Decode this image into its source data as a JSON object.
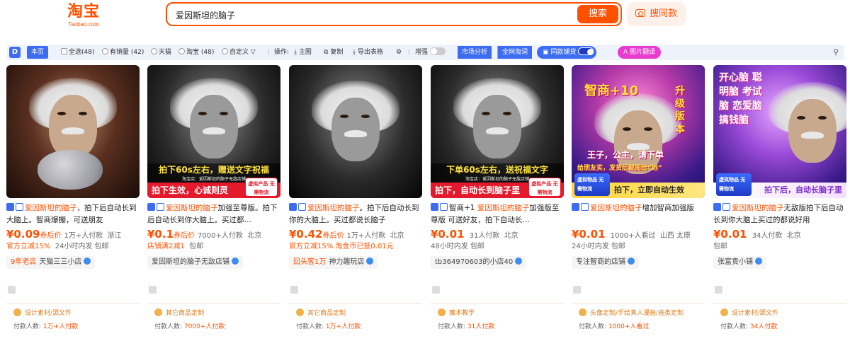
{
  "header": {
    "logo_cn": "淘宝",
    "logo_en": "Taobao.com",
    "search_query": "爱因斯坦的脑子",
    "search_button": "搜索",
    "same_style_button": "搜同款"
  },
  "toolbar": {
    "logo": "D",
    "this_page": "本页",
    "select_all": "全选(48)",
    "has_sales": "有销量 (42)",
    "tmall": "天猫",
    "taobao": "淘宝 (48)",
    "custom": "自定义",
    "ops_label": "操作:",
    "main_image": "主图",
    "copy": "复制",
    "export": "导出表格",
    "enhance": "增强",
    "market_analysis": "市场分析",
    "all_web": "全网淘词",
    "same_shop": "同款铺货",
    "image_translate": "图片翻译"
  },
  "products": [
    {
      "banner": "",
      "title_kw": "爱因斯坦的脑子",
      "title_prefix": "",
      "title_rest": "，拍下后自动长到大脑上。智商爆棚，可送朋友",
      "price": "¥0.09",
      "price_suffix": "券后价",
      "sales": "1万+人付款",
      "location": "浙江",
      "promo_red": "官方立减15%",
      "promo_grey": "24小时内发  包邮",
      "shop_badge": "9年老店",
      "shop": "天猫三三小店",
      "category": "设计素材/源文件",
      "paid_label": "付款人数:",
      "paid_value": "1万+人付款"
    },
    {
      "banner": "拍下60s左右，赠送文字祝福",
      "banner_small": "淘宝店：爱因斯坦的脑子无敌店铺",
      "banner2": "拍下生效，心诚则灵",
      "vtag": "虚拟产品 无需物流",
      "title_kw": "爱因斯坦的脑子",
      "title_prefix": "",
      "title_rest": "加强至尊版。拍下后自动长到你大脑上。买过都…",
      "price": "¥0.1",
      "price_suffix": "券后价",
      "sales": "7000+人付款",
      "location": "北京",
      "promo_red": "店铺满2减1",
      "promo_grey": "包邮",
      "shop_badge": "",
      "shop": "爱因斯坦的脑子无敌店铺",
      "category": "其它商品定制",
      "paid_label": "付款人数:",
      "paid_value": "7000+人付款"
    },
    {
      "banner": "",
      "title_kw": "爱因斯坦的脑子",
      "title_prefix": "",
      "title_rest": "。拍下后自动长到你的大脑上。买过都说长脑子",
      "price": "¥0.42",
      "price_suffix": "券后价",
      "sales": "1万+人付款",
      "location": "北京",
      "promo_red": "官方立减15%  淘金币已抵0.01元",
      "promo_grey": "",
      "shop_badge": "回头客1万",
      "shop": "神力趣玩店",
      "category": "其它商品定制",
      "paid_label": "付款人数:",
      "paid_value": "1万+人付款"
    },
    {
      "banner": "下单60s左右，送祝福文字",
      "banner_small": "淘宝店：爱因斯坦的脑子无敌店铺",
      "banner2": "拍下，自动长到脑子里",
      "vtag": "虚拟产品 无需物流",
      "title_kw": "爱因斯坦的脑子",
      "title_prefix": "智商+1 ",
      "title_rest": "加强版至尊版 可送好友，拍下自动长…",
      "price": "¥0.01",
      "price_suffix": "",
      "sales": "31人付款",
      "location": "北京",
      "promo_red": "",
      "promo_grey": "48小时内发  包邮",
      "shop_badge": "",
      "shop": "tb364970603的小店40",
      "category": "魔术教学",
      "paid_label": "付款人数:",
      "paid_value": "31人付款"
    },
    {
      "banner": "拍下，立即自动生效",
      "big_text": "智商+10",
      "side_text": "升级版本",
      "mid_text": "王子，公主，请下单",
      "mid_text2": "给朋友买，发货后截图给“她”",
      "vtag": "虚拟物品 无需物流",
      "title_kw": "爱因斯坦的脑子",
      "title_prefix": "",
      "title_rest": "增加智商加强版",
      "price": "¥0.01",
      "price_suffix": "",
      "sales": "1000+人看过",
      "location": "山西 太原",
      "promo_red": "",
      "promo_grey": "24小时内发  包邮",
      "shop_badge": "",
      "shop": "专注智商的店铺",
      "category": "头像定制/手绘真人漫画/画类定制",
      "paid_label": "付款人数:",
      "paid_value": "1000+人看过"
    },
    {
      "banner": "拍下后，自动长脑子里",
      "big_text": "开心脑 聪明脑 考试脑 恋爱脑 搞钱脑",
      "vtag": "虚拟物品 无需物流",
      "title_kw": "爱因斯坦的脑子",
      "title_prefix": "",
      "title_rest": "无敌版拍下后自动长到你大脑上买过的都说好用",
      "price": "¥0.01",
      "price_suffix": "",
      "sales": "34人付款",
      "location": "北京",
      "promo_red": "",
      "promo_grey": "包邮",
      "shop_badge": "",
      "shop": "张富贵小铺",
      "category": "设计素材/源文件",
      "paid_label": "付款人数:",
      "paid_value": "34人付款"
    }
  ],
  "colors": {
    "brand": "#ff5000",
    "accent_blue": "#3d6cf0"
  }
}
